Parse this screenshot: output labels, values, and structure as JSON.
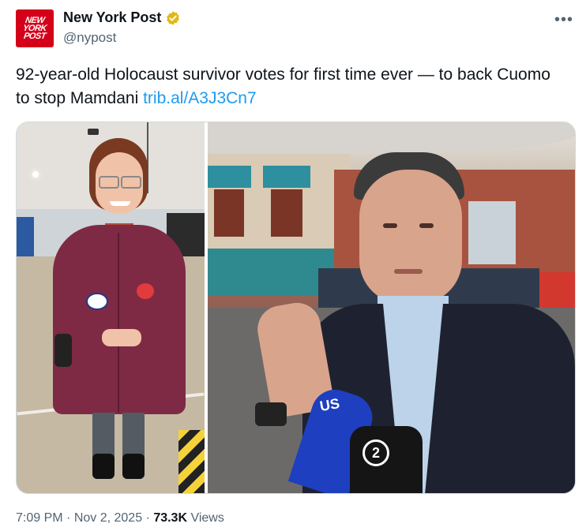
{
  "author": {
    "display_name": "New York Post",
    "handle": "@nypost",
    "avatar_lines": [
      "NEW",
      "YORK",
      "POST"
    ],
    "verified_color": "#e2b719",
    "avatar_color": "#d4001a"
  },
  "more_label": "•••",
  "post": {
    "text": "92-year-old Holocaust survivor votes for first time ever — to back Cuomo to stop Mamdani ",
    "link_text": "trib.al/A3J3Cn7"
  },
  "media": {
    "mic_labels": [
      "US",
      "2"
    ]
  },
  "meta": {
    "time": "7:09 PM",
    "separator": " · ",
    "date": "Nov 2, 2025",
    "views_count": "73.3K",
    "views_label": "Views"
  },
  "colors": {
    "link": "#1d9bf0",
    "secondary_text": "#536471",
    "primary_text": "#0f1419"
  }
}
